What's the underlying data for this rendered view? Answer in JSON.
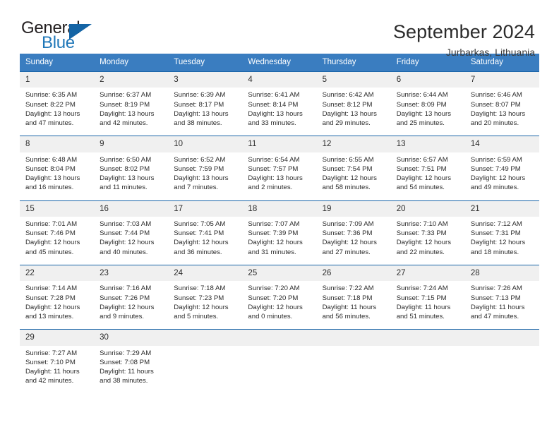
{
  "brand": {
    "name_part1": "General",
    "name_part2": "Blue",
    "accent_color": "#1464a5",
    "text_color": "#231f20"
  },
  "header": {
    "title": "September 2024",
    "subtitle": "Jurbarkas, Lithuania"
  },
  "calendar": {
    "header_bg": "#3a7dc0",
    "row_divider": "#1964a8",
    "daynum_bg": "#f0f0f0",
    "weekdays": [
      "Sunday",
      "Monday",
      "Tuesday",
      "Wednesday",
      "Thursday",
      "Friday",
      "Saturday"
    ],
    "weeks": [
      {
        "days": [
          {
            "num": "1",
            "lines": [
              "Sunrise: 6:35 AM",
              "Sunset: 8:22 PM",
              "Daylight: 13 hours",
              "and 47 minutes."
            ]
          },
          {
            "num": "2",
            "lines": [
              "Sunrise: 6:37 AM",
              "Sunset: 8:19 PM",
              "Daylight: 13 hours",
              "and 42 minutes."
            ]
          },
          {
            "num": "3",
            "lines": [
              "Sunrise: 6:39 AM",
              "Sunset: 8:17 PM",
              "Daylight: 13 hours",
              "and 38 minutes."
            ]
          },
          {
            "num": "4",
            "lines": [
              "Sunrise: 6:41 AM",
              "Sunset: 8:14 PM",
              "Daylight: 13 hours",
              "and 33 minutes."
            ]
          },
          {
            "num": "5",
            "lines": [
              "Sunrise: 6:42 AM",
              "Sunset: 8:12 PM",
              "Daylight: 13 hours",
              "and 29 minutes."
            ]
          },
          {
            "num": "6",
            "lines": [
              "Sunrise: 6:44 AM",
              "Sunset: 8:09 PM",
              "Daylight: 13 hours",
              "and 25 minutes."
            ]
          },
          {
            "num": "7",
            "lines": [
              "Sunrise: 6:46 AM",
              "Sunset: 8:07 PM",
              "Daylight: 13 hours",
              "and 20 minutes."
            ]
          }
        ]
      },
      {
        "days": [
          {
            "num": "8",
            "lines": [
              "Sunrise: 6:48 AM",
              "Sunset: 8:04 PM",
              "Daylight: 13 hours",
              "and 16 minutes."
            ]
          },
          {
            "num": "9",
            "lines": [
              "Sunrise: 6:50 AM",
              "Sunset: 8:02 PM",
              "Daylight: 13 hours",
              "and 11 minutes."
            ]
          },
          {
            "num": "10",
            "lines": [
              "Sunrise: 6:52 AM",
              "Sunset: 7:59 PM",
              "Daylight: 13 hours",
              "and 7 minutes."
            ]
          },
          {
            "num": "11",
            "lines": [
              "Sunrise: 6:54 AM",
              "Sunset: 7:57 PM",
              "Daylight: 13 hours",
              "and 2 minutes."
            ]
          },
          {
            "num": "12",
            "lines": [
              "Sunrise: 6:55 AM",
              "Sunset: 7:54 PM",
              "Daylight: 12 hours",
              "and 58 minutes."
            ]
          },
          {
            "num": "13",
            "lines": [
              "Sunrise: 6:57 AM",
              "Sunset: 7:51 PM",
              "Daylight: 12 hours",
              "and 54 minutes."
            ]
          },
          {
            "num": "14",
            "lines": [
              "Sunrise: 6:59 AM",
              "Sunset: 7:49 PM",
              "Daylight: 12 hours",
              "and 49 minutes."
            ]
          }
        ]
      },
      {
        "days": [
          {
            "num": "15",
            "lines": [
              "Sunrise: 7:01 AM",
              "Sunset: 7:46 PM",
              "Daylight: 12 hours",
              "and 45 minutes."
            ]
          },
          {
            "num": "16",
            "lines": [
              "Sunrise: 7:03 AM",
              "Sunset: 7:44 PM",
              "Daylight: 12 hours",
              "and 40 minutes."
            ]
          },
          {
            "num": "17",
            "lines": [
              "Sunrise: 7:05 AM",
              "Sunset: 7:41 PM",
              "Daylight: 12 hours",
              "and 36 minutes."
            ]
          },
          {
            "num": "18",
            "lines": [
              "Sunrise: 7:07 AM",
              "Sunset: 7:39 PM",
              "Daylight: 12 hours",
              "and 31 minutes."
            ]
          },
          {
            "num": "19",
            "lines": [
              "Sunrise: 7:09 AM",
              "Sunset: 7:36 PM",
              "Daylight: 12 hours",
              "and 27 minutes."
            ]
          },
          {
            "num": "20",
            "lines": [
              "Sunrise: 7:10 AM",
              "Sunset: 7:33 PM",
              "Daylight: 12 hours",
              "and 22 minutes."
            ]
          },
          {
            "num": "21",
            "lines": [
              "Sunrise: 7:12 AM",
              "Sunset: 7:31 PM",
              "Daylight: 12 hours",
              "and 18 minutes."
            ]
          }
        ]
      },
      {
        "days": [
          {
            "num": "22",
            "lines": [
              "Sunrise: 7:14 AM",
              "Sunset: 7:28 PM",
              "Daylight: 12 hours",
              "and 13 minutes."
            ]
          },
          {
            "num": "23",
            "lines": [
              "Sunrise: 7:16 AM",
              "Sunset: 7:26 PM",
              "Daylight: 12 hours",
              "and 9 minutes."
            ]
          },
          {
            "num": "24",
            "lines": [
              "Sunrise: 7:18 AM",
              "Sunset: 7:23 PM",
              "Daylight: 12 hours",
              "and 5 minutes."
            ]
          },
          {
            "num": "25",
            "lines": [
              "Sunrise: 7:20 AM",
              "Sunset: 7:20 PM",
              "Daylight: 12 hours",
              "and 0 minutes."
            ]
          },
          {
            "num": "26",
            "lines": [
              "Sunrise: 7:22 AM",
              "Sunset: 7:18 PM",
              "Daylight: 11 hours",
              "and 56 minutes."
            ]
          },
          {
            "num": "27",
            "lines": [
              "Sunrise: 7:24 AM",
              "Sunset: 7:15 PM",
              "Daylight: 11 hours",
              "and 51 minutes."
            ]
          },
          {
            "num": "28",
            "lines": [
              "Sunrise: 7:26 AM",
              "Sunset: 7:13 PM",
              "Daylight: 11 hours",
              "and 47 minutes."
            ]
          }
        ]
      },
      {
        "days": [
          {
            "num": "29",
            "lines": [
              "Sunrise: 7:27 AM",
              "Sunset: 7:10 PM",
              "Daylight: 11 hours",
              "and 42 minutes."
            ]
          },
          {
            "num": "30",
            "lines": [
              "Sunrise: 7:29 AM",
              "Sunset: 7:08 PM",
              "Daylight: 11 hours",
              "and 38 minutes."
            ]
          },
          {
            "num": "",
            "lines": []
          },
          {
            "num": "",
            "lines": []
          },
          {
            "num": "",
            "lines": []
          },
          {
            "num": "",
            "lines": []
          },
          {
            "num": "",
            "lines": []
          }
        ]
      }
    ]
  }
}
